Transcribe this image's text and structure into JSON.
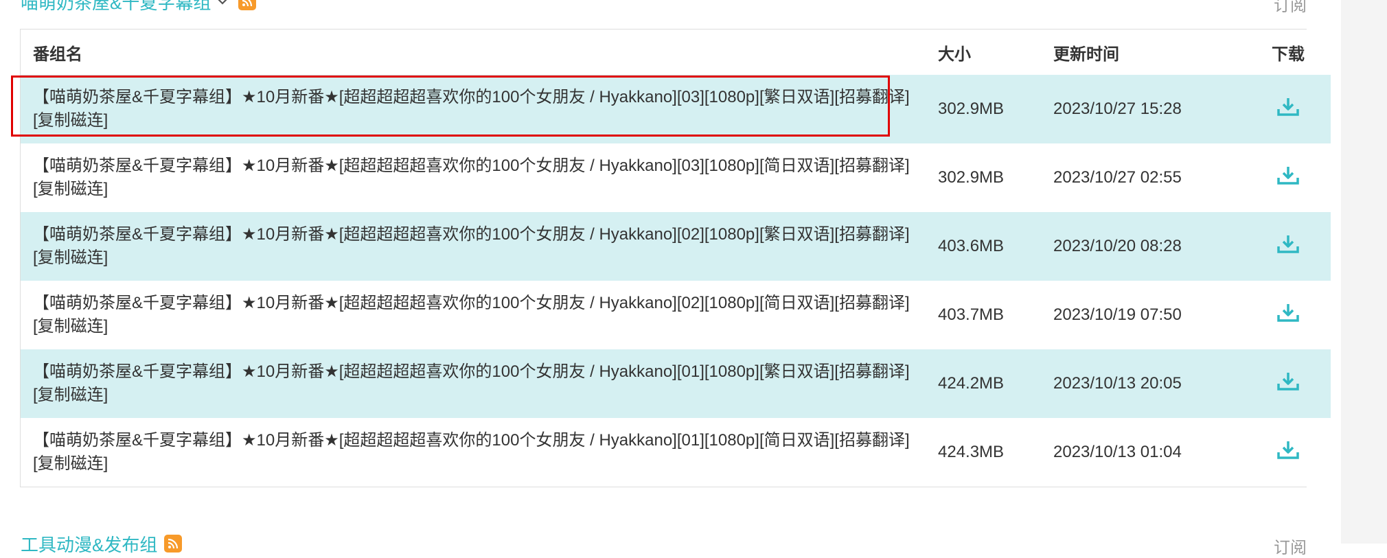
{
  "groups": {
    "top": {
      "title": "喵萌奶茶屋&千夏字幕组",
      "subscribe_label": "订阅"
    },
    "bottom": {
      "title": "工具动漫&发布组",
      "subscribe_label": "订阅"
    }
  },
  "table": {
    "headers": {
      "title": "番组名",
      "size": "大小",
      "time": "更新时间",
      "download": "下载"
    },
    "rows": [
      {
        "title": "【喵萌奶茶屋&千夏字幕组】★10月新番★[超超超超超喜欢你的100个女朋友 / Hyakkano][03][1080p][繁日双语][招募翻译]",
        "magnet": "[复制磁连]",
        "size": "302.9MB",
        "time": "2023/10/27 15:28",
        "highlighted": true
      },
      {
        "title": "【喵萌奶茶屋&千夏字幕组】★10月新番★[超超超超超喜欢你的100个女朋友 / Hyakkano][03][1080p][简日双语][招募翻译]",
        "magnet": "[复制磁连]",
        "size": "302.9MB",
        "time": "2023/10/27 02:55"
      },
      {
        "title": "【喵萌奶茶屋&千夏字幕组】★10月新番★[超超超超超喜欢你的100个女朋友 / Hyakkano][02][1080p][繁日双语][招募翻译]",
        "magnet": "[复制磁连]",
        "size": "403.6MB",
        "time": "2023/10/20 08:28"
      },
      {
        "title": "【喵萌奶茶屋&千夏字幕组】★10月新番★[超超超超超喜欢你的100个女朋友 / Hyakkano][02][1080p][简日双语][招募翻译]",
        "magnet": "[复制磁连]",
        "size": "403.7MB",
        "time": "2023/10/19 07:50"
      },
      {
        "title": "【喵萌奶茶屋&千夏字幕组】★10月新番★[超超超超超喜欢你的100个女朋友 / Hyakkano][01][1080p][繁日双语][招募翻译]",
        "magnet": "[复制磁连]",
        "size": "424.2MB",
        "time": "2023/10/13 20:05"
      },
      {
        "title": "【喵萌奶茶屋&千夏字幕组】★10月新番★[超超超超超喜欢你的100个女朋友 / Hyakkano][01][1080p][简日双语][招募翻译]",
        "magnet": "[复制磁连]",
        "size": "424.3MB",
        "time": "2023/10/13 01:04"
      }
    ]
  },
  "icons": {
    "download": "download-icon",
    "rss": "rss-icon",
    "chevron": "chevron-down-icon"
  },
  "colors": {
    "accent": "#2fb8c3",
    "row_alt": "#d5f0f2",
    "highlight": "#e00000",
    "rss": "#f79a2a"
  }
}
